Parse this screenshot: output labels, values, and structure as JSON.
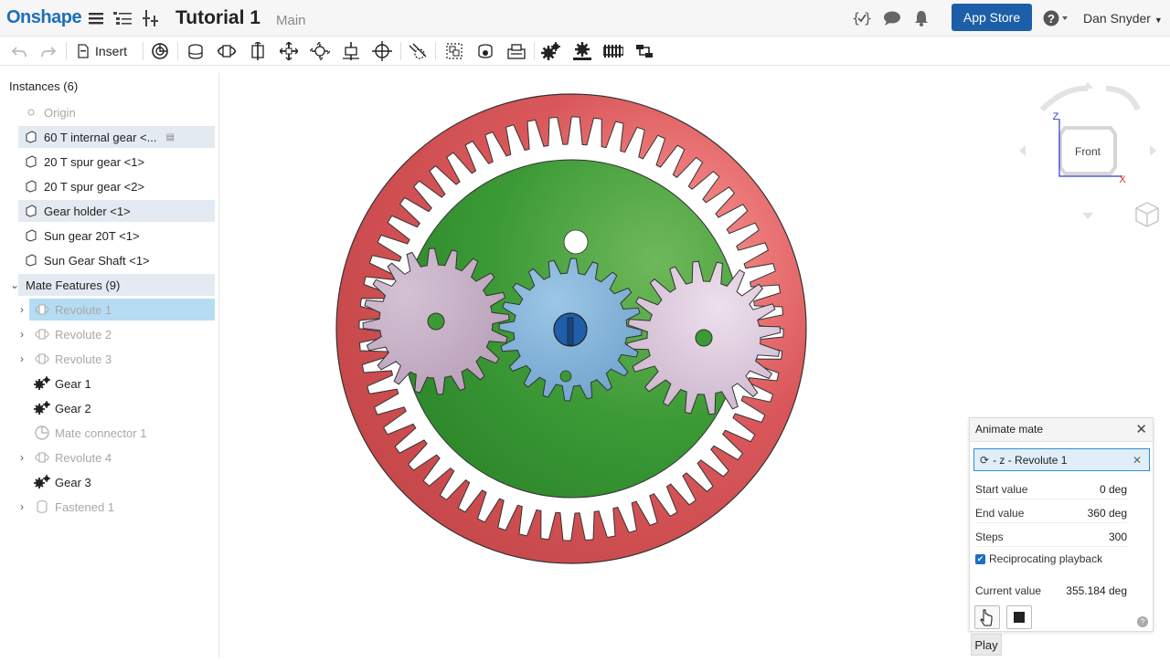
{
  "app": {
    "logo": "Onshape",
    "title": "Tutorial 1",
    "branch": "Main"
  },
  "header": {
    "appstore_label": "App Store",
    "help_icon": "?",
    "user_name": "Dan Snyder"
  },
  "toolbar": {
    "insert_label": "Insert"
  },
  "instances": {
    "title": "Instances (6)",
    "origin_label": "Origin",
    "items": [
      {
        "label": "60 T internal gear <..."
      },
      {
        "label": "20 T spur gear <1>"
      },
      {
        "label": "20 T spur gear <2>"
      },
      {
        "label": "Gear holder <1>"
      },
      {
        "label": "Sun gear 20T <1>"
      },
      {
        "label": "Sun Gear Shaft <1>"
      }
    ]
  },
  "mates": {
    "title": "Mate Features (9)",
    "items": [
      {
        "label": "Revolute 1"
      },
      {
        "label": "Revolute 2"
      },
      {
        "label": "Revolute 3"
      },
      {
        "label": "Gear 1"
      },
      {
        "label": "Gear 2"
      },
      {
        "label": "Mate connector 1"
      },
      {
        "label": "Revolute 4"
      },
      {
        "label": "Gear 3"
      },
      {
        "label": "Fastened 1"
      }
    ]
  },
  "viewcube": {
    "face_label": "Front",
    "z_label": "Z",
    "x_label": "X"
  },
  "animate": {
    "title": "Animate mate",
    "mate_field": "- z - Revolute 1",
    "start_label": "Start value",
    "start_value": "0 deg",
    "end_label": "End value",
    "end_value": "360 deg",
    "steps_label": "Steps",
    "steps_value": "300",
    "reciprocating_label": "Reciprocating playback",
    "current_label": "Current value",
    "current_value": "355.184 deg",
    "tooltip": "Play"
  },
  "colors": {
    "ring_gear": "#d45a5c",
    "holder": "#3d9a3a",
    "sun_gear": "#82b2d8",
    "planet_gear": "#c9b4c9",
    "accent": "#1c5ea8"
  }
}
